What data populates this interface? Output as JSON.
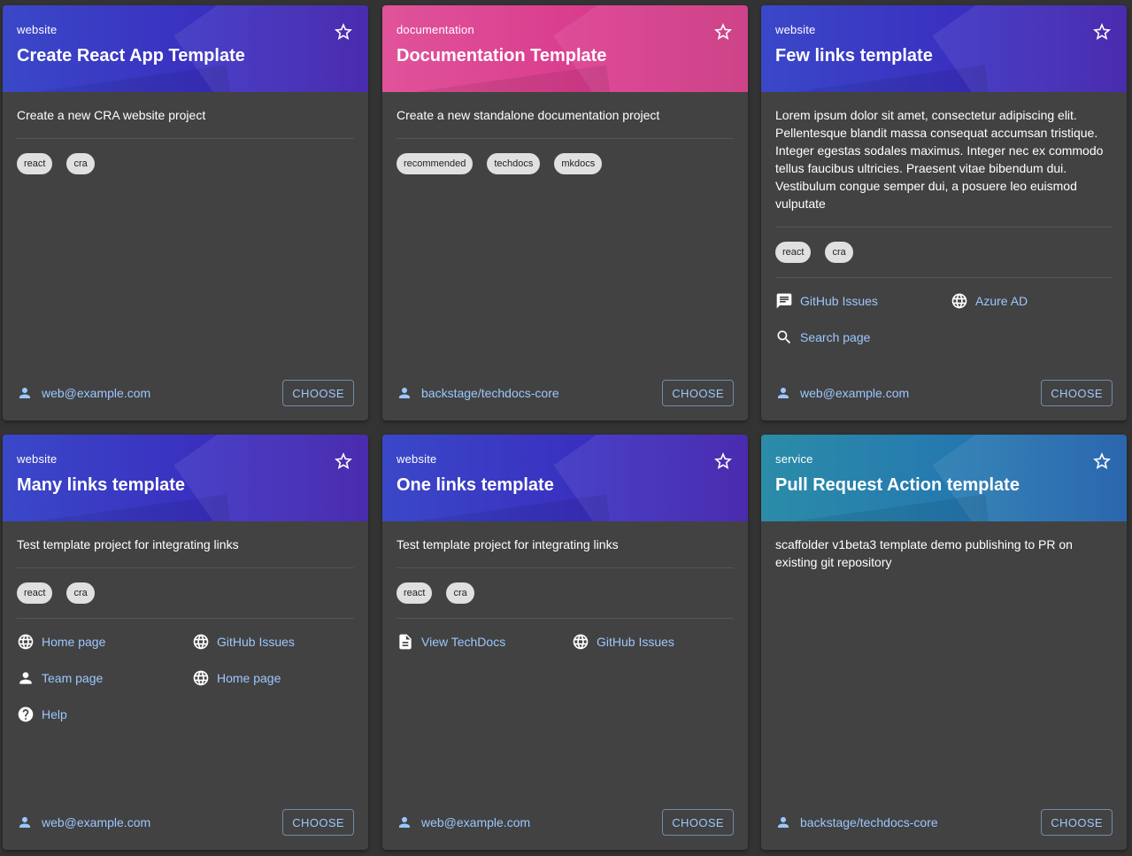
{
  "cards": [
    {
      "kind": "website",
      "title": "Create React App Template",
      "description": "Create a new CRA website project",
      "tags": [
        "react",
        "cra"
      ],
      "links": [],
      "owner": "web@example.com",
      "choose_label": "CHOOSE"
    },
    {
      "kind": "documentation",
      "title": "Documentation Template",
      "description": "Create a new standalone documentation project",
      "tags": [
        "recommended",
        "techdocs",
        "mkdocs"
      ],
      "links": [],
      "owner": "backstage/techdocs-core",
      "choose_label": "CHOOSE"
    },
    {
      "kind": "website",
      "title": "Few links template",
      "description": "Lorem ipsum dolor sit amet, consectetur adipiscing elit.\nPellentesque blandit massa consequat accumsan tristique.\nInteger egestas sodales maximus. Integer nec ex commodo\ntellus faucibus ultricies. Praesent vitae bibendum dui.\nVestibulum congue semper dui, a posuere leo euismod\nvulputate",
      "tags": [
        "react",
        "cra"
      ],
      "links": [
        {
          "label": "GitHub Issues",
          "icon": "chat-icon"
        },
        {
          "label": "Azure AD",
          "icon": "globe-icon"
        },
        {
          "label": "Search page",
          "icon": "search-icon"
        }
      ],
      "owner": "web@example.com",
      "choose_label": "CHOOSE"
    },
    {
      "kind": "website",
      "title": "Many links template",
      "description": "Test template project for integrating links",
      "tags": [
        "react",
        "cra"
      ],
      "links": [
        {
          "label": "Home page",
          "icon": "globe-icon"
        },
        {
          "label": "GitHub Issues",
          "icon": "globe-icon"
        },
        {
          "label": "Team page",
          "icon": "person-icon"
        },
        {
          "label": "Home page",
          "icon": "globe-icon"
        },
        {
          "label": "Help",
          "icon": "help-icon"
        }
      ],
      "owner": "web@example.com",
      "choose_label": "CHOOSE"
    },
    {
      "kind": "website",
      "title": "One links template",
      "description": "Test template project for integrating links",
      "tags": [
        "react",
        "cra"
      ],
      "links": [
        {
          "label": "View TechDocs",
          "icon": "document-icon"
        },
        {
          "label": "GitHub Issues",
          "icon": "globe-icon"
        }
      ],
      "owner": "web@example.com",
      "choose_label": "CHOOSE"
    },
    {
      "kind": "service",
      "title": "Pull Request Action template",
      "description": "scaffolder v1beta3 template demo publishing to PR on\nexisting git repository",
      "tags": [],
      "links": [],
      "owner": "backstage/techdocs-core",
      "choose_label": "CHOOSE"
    }
  ]
}
